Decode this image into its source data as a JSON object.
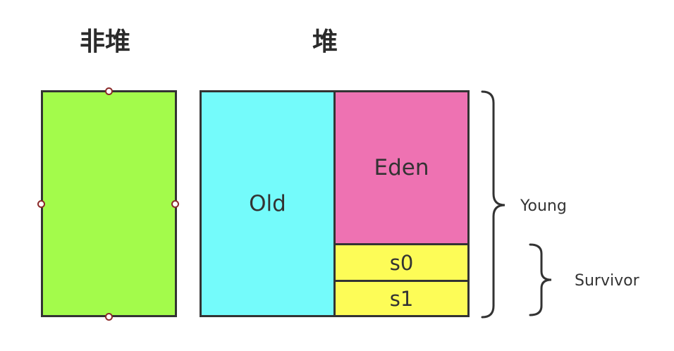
{
  "titles": {
    "non_heap": "非堆",
    "heap": "堆"
  },
  "regions": {
    "old": "Old",
    "eden": "Eden",
    "s0": "s0",
    "s1": "s1"
  },
  "braces": {
    "young": "Young",
    "survivor": "Survivor"
  },
  "colors": {
    "non_heap_fill": "#a3fb4b",
    "old_fill": "#74fbfb",
    "eden_fill": "#ee72b2",
    "survivor_fill": "#fdfc57",
    "border": "#333333",
    "handle_stroke": "#8b2a2a"
  }
}
